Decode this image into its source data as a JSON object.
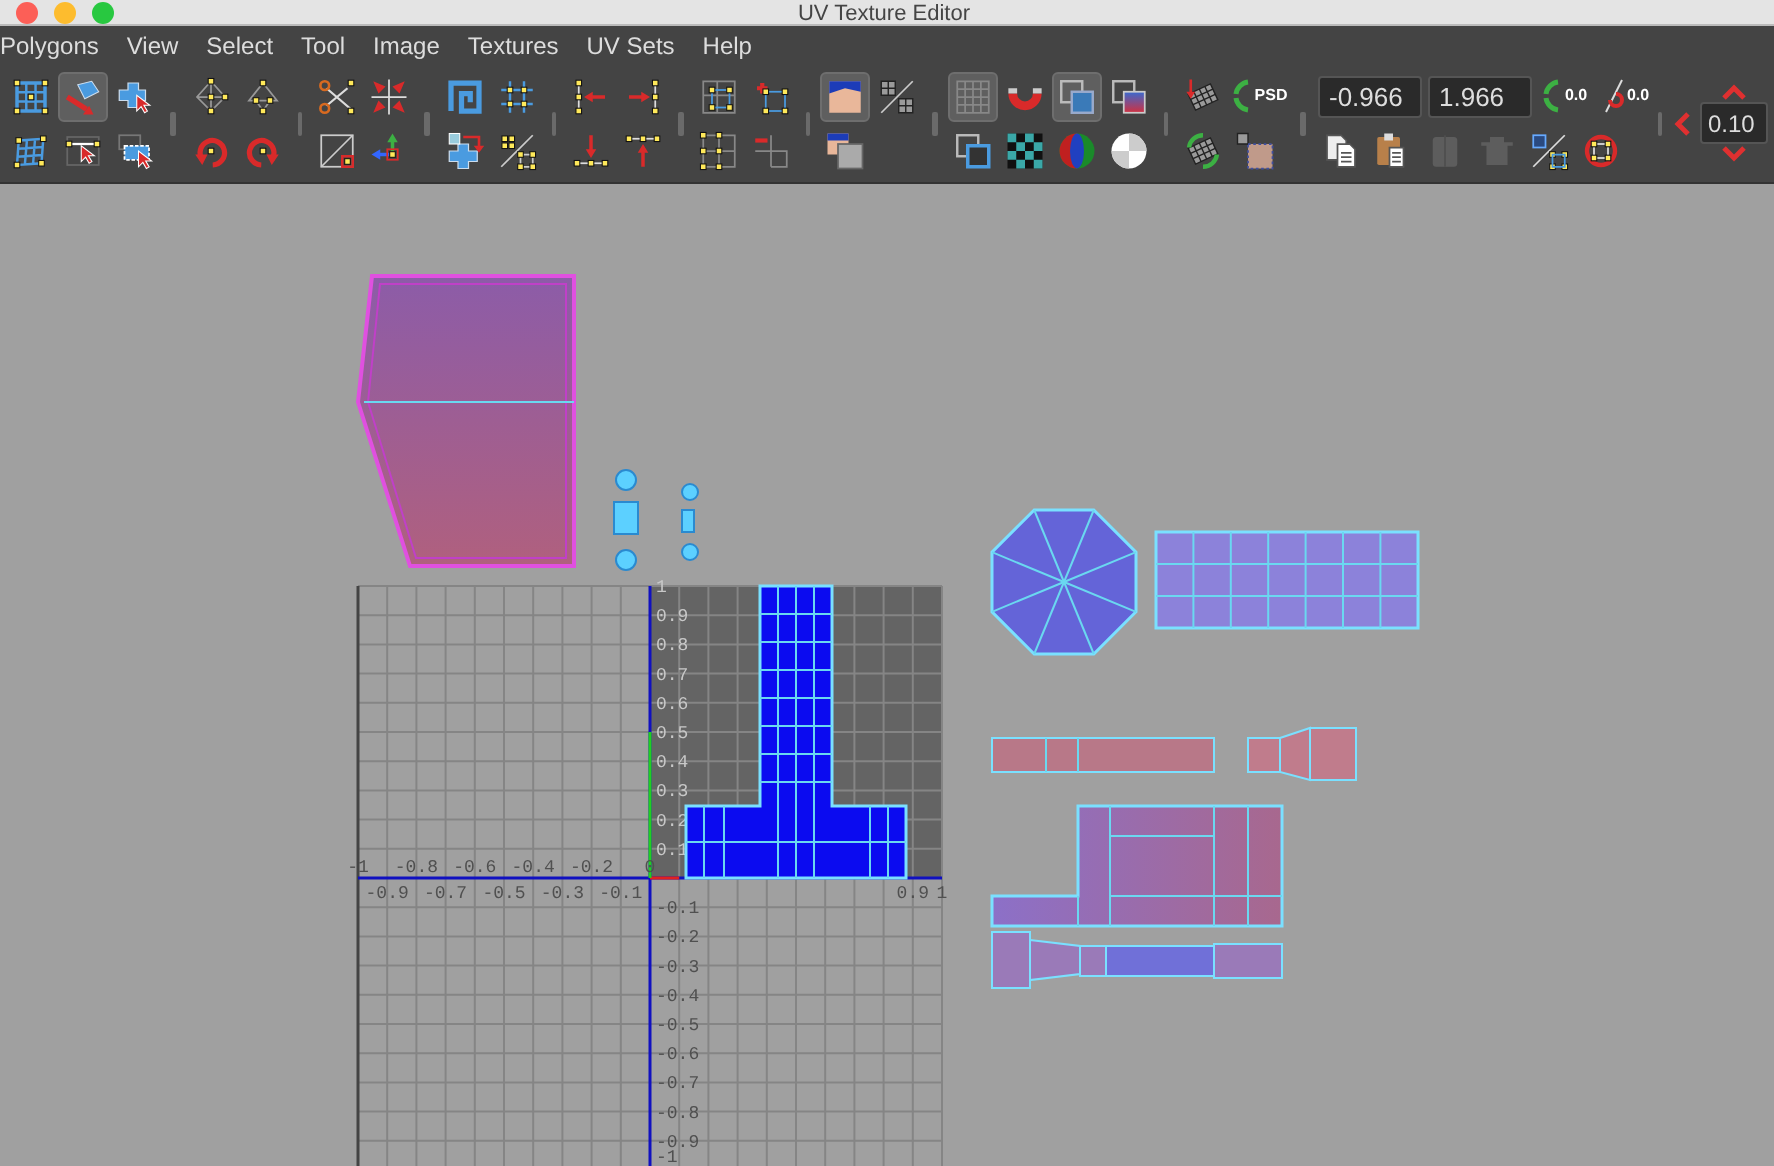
{
  "window": {
    "title": "UV Texture Editor"
  },
  "menu": [
    "Polygons",
    "View",
    "Select",
    "Tool",
    "Image",
    "Textures",
    "UV Sets",
    "Help"
  ],
  "toolbar": [
    {
      "rows": [
        [
          {
            "kind": "tool",
            "pressed": false,
            "disabled": false
          },
          {
            "kind": "tool",
            "pressed": true,
            "disabled": false
          },
          {
            "kind": "tool",
            "pressed": false,
            "disabled": false
          }
        ],
        [
          {
            "kind": "tool",
            "pressed": false,
            "disabled": false
          },
          {
            "kind": "tool",
            "pressed": false,
            "disabled": false
          },
          {
            "kind": "tool",
            "pressed": false,
            "disabled": false
          }
        ]
      ]
    },
    {
      "rows": [
        [
          {
            "kind": "tool",
            "pressed": false,
            "disabled": false
          },
          {
            "kind": "tool",
            "pressed": false,
            "disabled": false
          }
        ],
        [
          {
            "kind": "tool",
            "pressed": false,
            "disabled": false
          },
          {
            "kind": "tool",
            "pressed": false,
            "disabled": false
          }
        ]
      ]
    },
    {
      "rows": [
        [
          {
            "kind": "tool",
            "pressed": false,
            "disabled": false
          },
          {
            "kind": "tool",
            "pressed": false,
            "disabled": false
          }
        ],
        [
          {
            "kind": "tool",
            "pressed": false,
            "disabled": false
          },
          {
            "kind": "tool",
            "pressed": false,
            "disabled": false
          }
        ]
      ]
    },
    {
      "rows": [
        [
          {
            "kind": "tool",
            "pressed": false,
            "disabled": false
          },
          {
            "kind": "tool",
            "pressed": false,
            "disabled": false
          }
        ],
        [
          {
            "kind": "tool",
            "pressed": false,
            "disabled": false
          },
          {
            "kind": "tool",
            "pressed": false,
            "disabled": false
          }
        ]
      ]
    },
    {
      "rows": [
        [
          {
            "kind": "tool",
            "pressed": false,
            "disabled": false
          },
          {
            "kind": "tool",
            "pressed": false,
            "disabled": false
          }
        ],
        [
          {
            "kind": "tool",
            "pressed": false,
            "disabled": false
          },
          {
            "kind": "tool",
            "pressed": false,
            "disabled": false
          }
        ]
      ]
    },
    {
      "rows": [
        [
          {
            "kind": "tool",
            "pressed": false,
            "disabled": false
          },
          {
            "kind": "tool",
            "pressed": false,
            "disabled": false
          }
        ],
        [
          {
            "kind": "tool",
            "pressed": false,
            "disabled": false
          },
          {
            "kind": "tool",
            "pressed": false,
            "disabled": false
          }
        ]
      ]
    },
    {
      "rows": [
        [
          {
            "kind": "tool",
            "pressed": true,
            "disabled": false
          },
          {
            "kind": "tool",
            "pressed": false,
            "disabled": false
          }
        ],
        [
          {
            "kind": "tool",
            "pressed": false,
            "disabled": false
          }
        ]
      ]
    },
    {
      "rows": [
        [
          {
            "kind": "tool",
            "pressed": true,
            "disabled": false
          },
          {
            "kind": "tool",
            "pressed": false,
            "disabled": false
          },
          {
            "kind": "tool",
            "pressed": true,
            "disabled": false
          },
          {
            "kind": "tool",
            "pressed": false,
            "disabled": false
          }
        ],
        [
          {
            "kind": "tool",
            "pressed": false,
            "disabled": false
          },
          {
            "kind": "tool",
            "pressed": false,
            "disabled": false
          },
          {
            "kind": "tool",
            "pressed": false,
            "disabled": false
          },
          {
            "kind": "tool",
            "pressed": false,
            "disabled": false
          }
        ]
      ]
    },
    {
      "rows": [
        [
          {
            "kind": "tool",
            "pressed": false,
            "disabled": false
          },
          {
            "kind": "tool",
            "pressed": false,
            "disabled": false,
            "label": "PSD"
          }
        ],
        [
          {
            "kind": "tool",
            "pressed": false,
            "disabled": false
          },
          {
            "kind": "tool",
            "pressed": false,
            "disabled": false
          }
        ]
      ]
    },
    {
      "rows": [
        [
          {
            "kind": "field",
            "value": "-0.966"
          },
          {
            "kind": "field",
            "value": "1.966"
          },
          {
            "kind": "tool",
            "pressed": false,
            "disabled": false,
            "label": "0.0"
          },
          {
            "kind": "tool",
            "pressed": false,
            "disabled": false,
            "label": "0.0"
          }
        ],
        [
          {
            "kind": "tool",
            "pressed": false,
            "disabled": false
          },
          {
            "kind": "tool",
            "pressed": false,
            "disabled": false
          },
          {
            "kind": "tool",
            "pressed": false,
            "disabled": true
          },
          {
            "kind": "tool",
            "pressed": false,
            "disabled": true
          },
          {
            "kind": "tool",
            "pressed": false,
            "disabled": false
          },
          {
            "kind": "tool",
            "pressed": false,
            "disabled": false
          }
        ]
      ]
    },
    {
      "rows": [
        [
          {
            "kind": "stepper",
            "value": "0.10"
          }
        ]
      ]
    }
  ],
  "canvas": {
    "u_labels": [
      "-1",
      "-0.9",
      "-0.8",
      "-0.7",
      "-0.6",
      "-0.5",
      "-0.4",
      "-0.3",
      "-0.2",
      "-0.1",
      "0",
      "0.9",
      "1"
    ],
    "v_labels": [
      "1",
      "0.9",
      "0.8",
      "0.7",
      "0.6",
      "0.5",
      "0.4",
      "0.3",
      "0.2",
      "0.1",
      "-0.1",
      "-0.2",
      "-0.3",
      "-0.4",
      "-0.5",
      "-0.6",
      "-0.7",
      "-0.8",
      "-0.9",
      "-1"
    ],
    "shells": [
      {
        "kind": "box",
        "selected": false
      },
      {
        "kind": "pins",
        "selected": false
      },
      {
        "kind": "t-shape",
        "selected": true
      },
      {
        "kind": "octagon",
        "selected": false
      },
      {
        "kind": "grid-strip",
        "selected": false
      },
      {
        "kind": "bar",
        "selected": false
      },
      {
        "kind": "cylinder",
        "selected": false
      },
      {
        "kind": "block",
        "selected": false
      },
      {
        "kind": "handle",
        "selected": false
      }
    ]
  }
}
